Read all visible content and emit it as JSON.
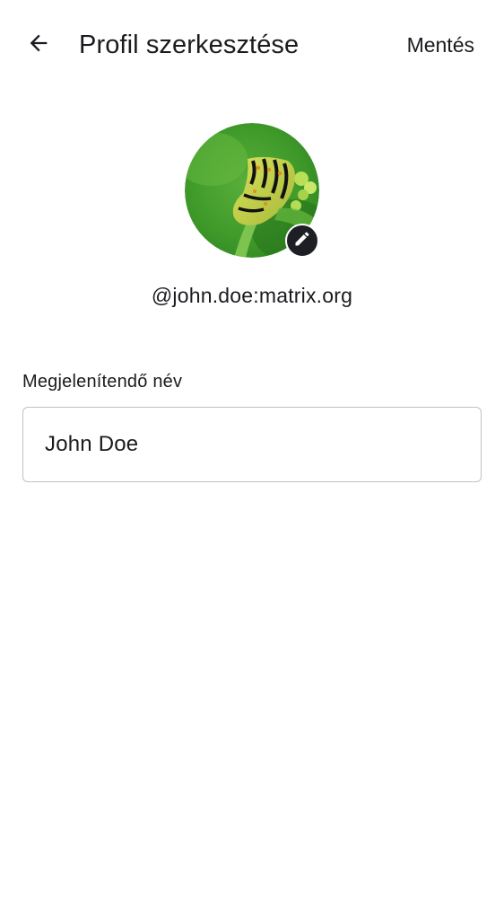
{
  "app_bar": {
    "back_icon": "arrow-back-icon",
    "title": "Profil szerkesztése",
    "save_label": "Mentés"
  },
  "profile": {
    "avatar_description_icon": "caterpillar-photo",
    "edit_icon": "pencil-icon",
    "user_id": "@john.doe:matrix.org"
  },
  "display_name_field": {
    "label": "Megjelenítendő név",
    "value": "John Doe"
  },
  "colors": {
    "text": "#1b1b1f",
    "outline": "#c2c2c6",
    "badge": "#1e1f24",
    "background": "#ffffff"
  }
}
